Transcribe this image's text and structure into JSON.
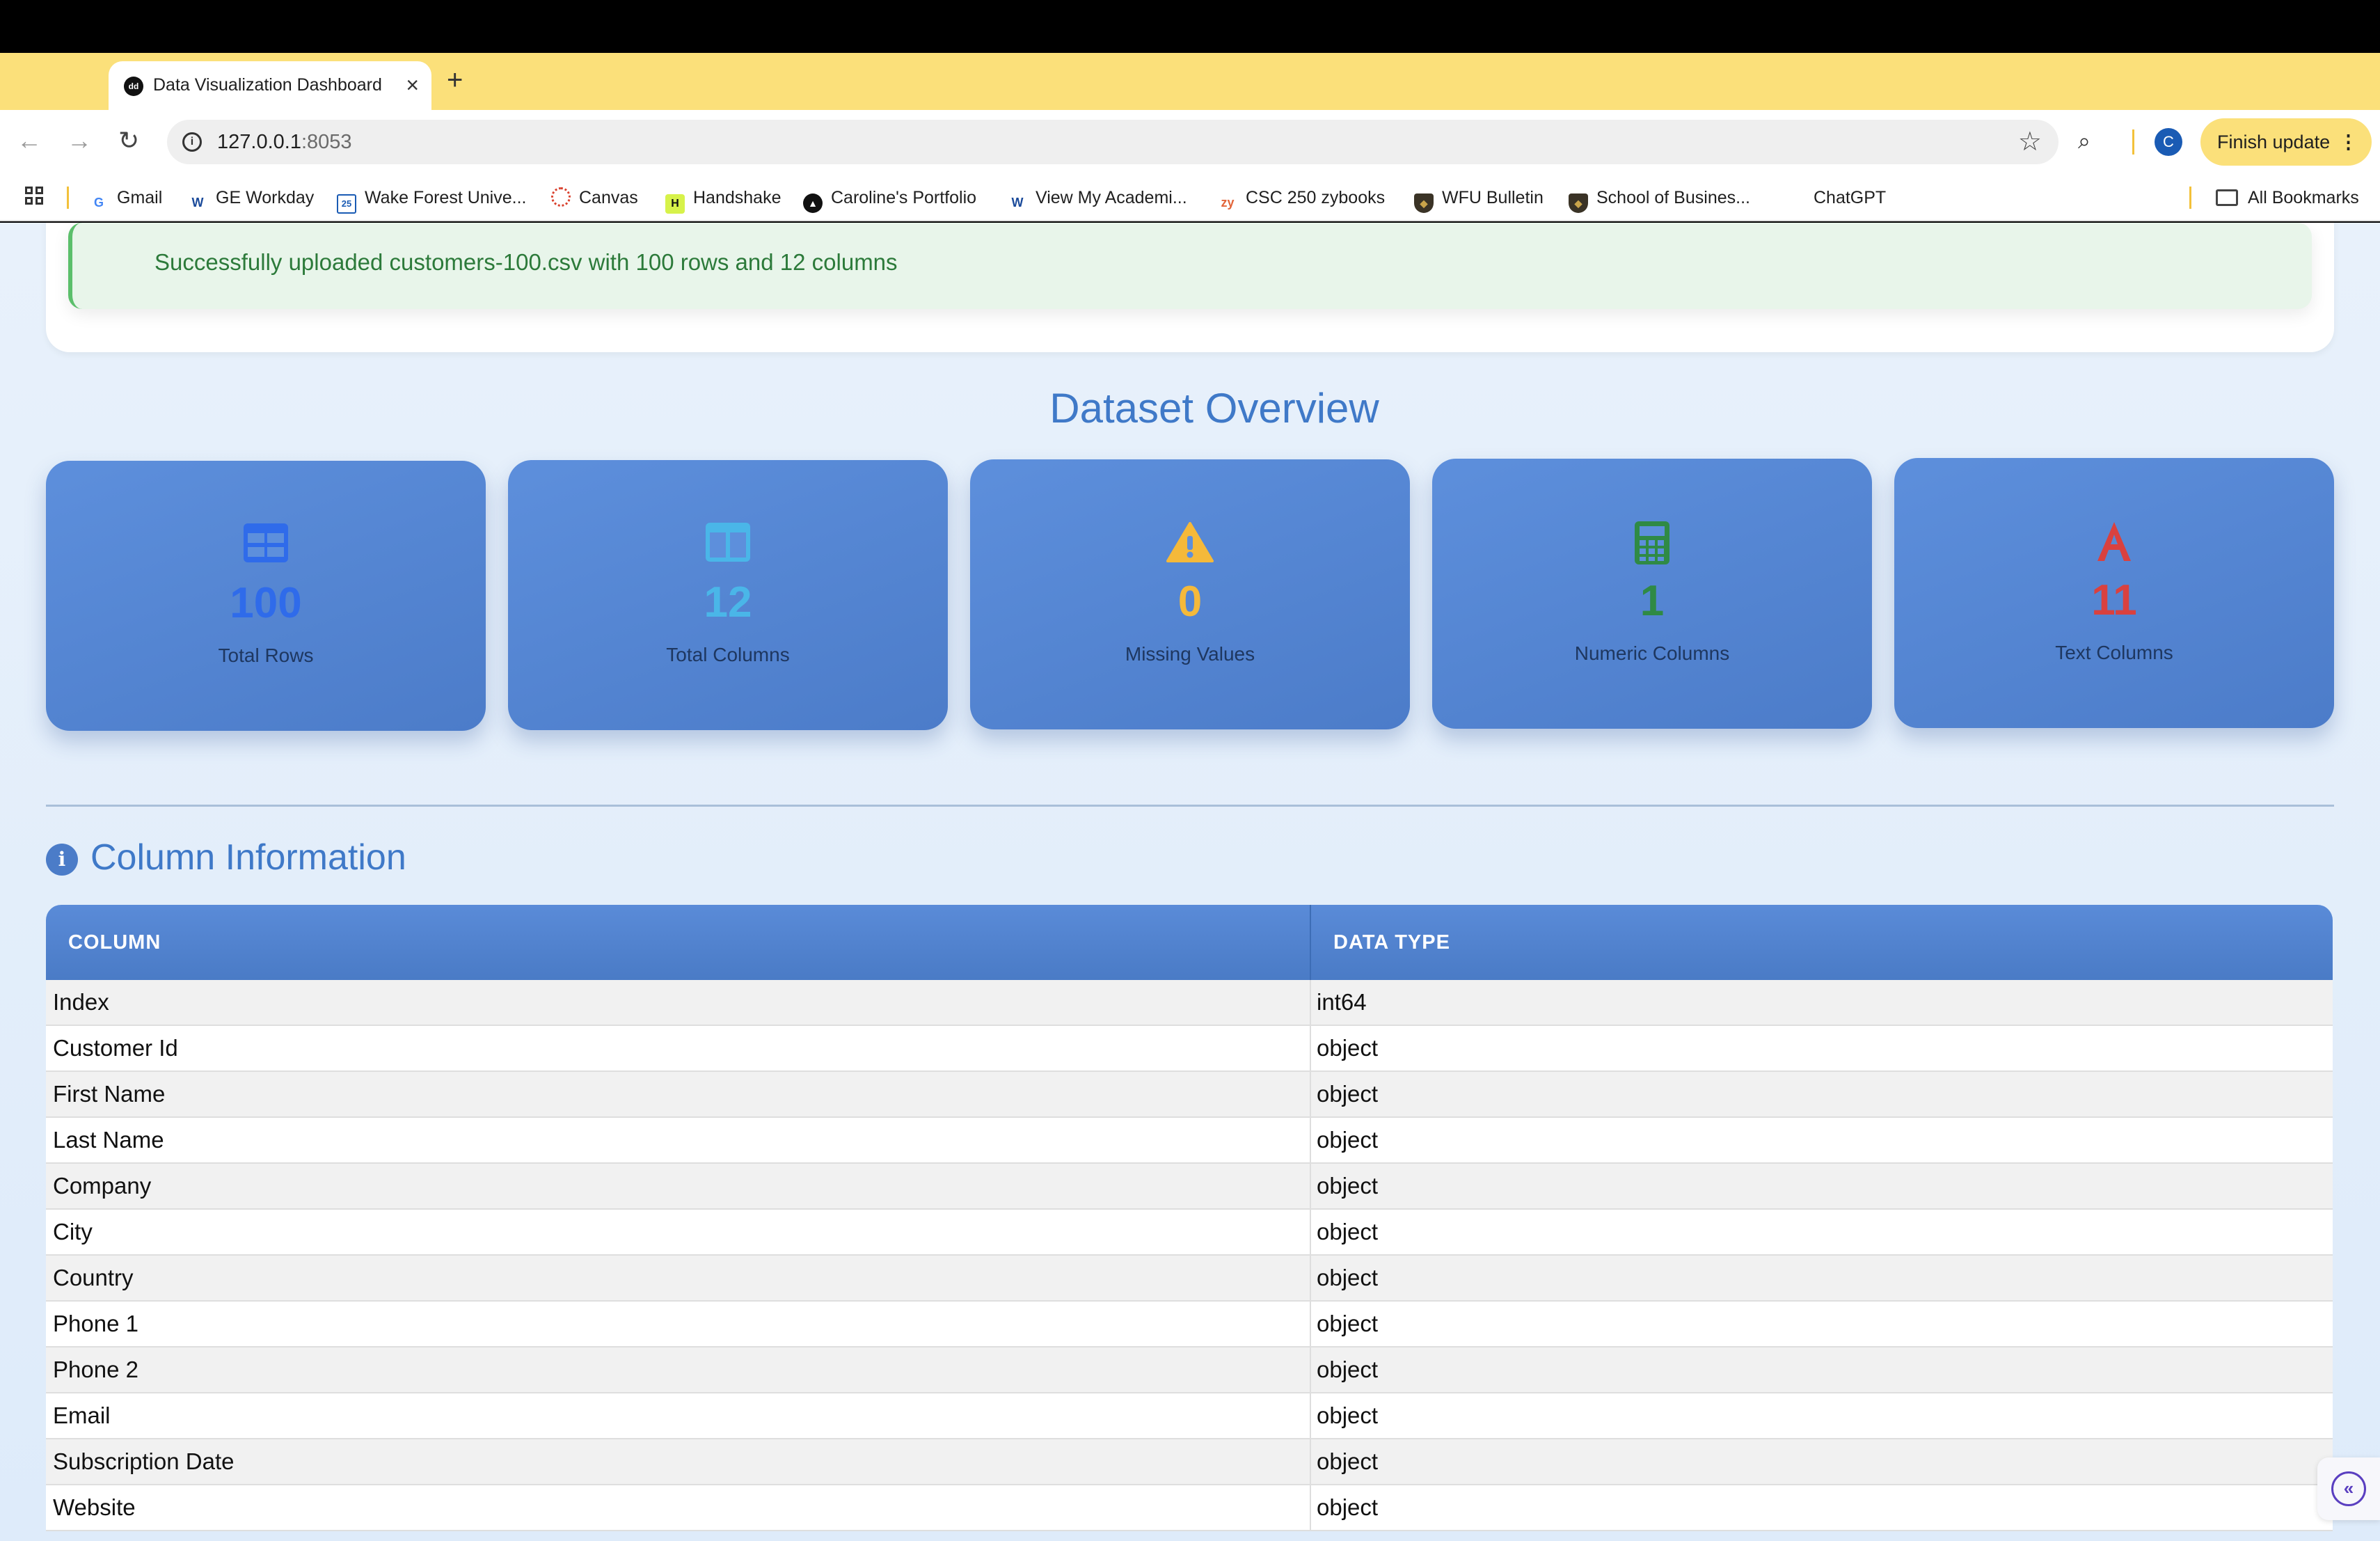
{
  "browser": {
    "tab_title": "Data Visualization Dashboard",
    "url_host": "127.0.0.1",
    "url_port": ":8053",
    "profile_initial": "C",
    "finish_update_label": "Finish update",
    "bookmarks": [
      {
        "label": "Gmail",
        "icon": "google-icon"
      },
      {
        "label": "GE Workday",
        "icon": "workday-icon"
      },
      {
        "label": "Wake Forest Unive...",
        "icon": "calendar-icon"
      },
      {
        "label": "Canvas",
        "icon": "canvas-icon"
      },
      {
        "label": "Handshake",
        "icon": "handshake-icon"
      },
      {
        "label": "Caroline's Portfolio",
        "icon": "portfolio-icon"
      },
      {
        "label": "View My Academi...",
        "icon": "workday-icon"
      },
      {
        "label": "CSC 250 zybooks",
        "icon": "zybooks-icon"
      },
      {
        "label": "WFU Bulletin",
        "icon": "shield-icon"
      },
      {
        "label": "School of Busines...",
        "icon": "shield-icon"
      },
      {
        "label": "ChatGPT",
        "icon": ""
      }
    ],
    "all_bookmarks_label": "All Bookmarks"
  },
  "upload": {
    "message": "Successfully uploaded customers-100.csv with 100 rows and 12 columns"
  },
  "overview": {
    "title": "Dataset Overview",
    "stats": [
      {
        "value": "100",
        "label": "Total Rows",
        "icon": "table-icon",
        "color": "#2f6bea"
      },
      {
        "value": "12",
        "label": "Total Columns",
        "icon": "columns-icon",
        "color": "#4ab6e8"
      },
      {
        "value": "0",
        "label": "Missing Values",
        "icon": "warning-icon",
        "color": "#f5b93a"
      },
      {
        "value": "1",
        "label": "Numeric Columns",
        "icon": "calculator-icon",
        "color": "#2f8a45"
      },
      {
        "value": "11",
        "label": "Text Columns",
        "icon": "font-icon",
        "color": "#d9413f"
      }
    ]
  },
  "column_info": {
    "title": "Column Information",
    "headers": [
      "COLUMN",
      "DATA TYPE"
    ],
    "rows": [
      [
        "Index",
        "int64"
      ],
      [
        "Customer Id",
        "object"
      ],
      [
        "First Name",
        "object"
      ],
      [
        "Last Name",
        "object"
      ],
      [
        "Company",
        "object"
      ],
      [
        "City",
        "object"
      ],
      [
        "Country",
        "object"
      ],
      [
        "Phone 1",
        "object"
      ],
      [
        "Phone 2",
        "object"
      ],
      [
        "Email",
        "object"
      ],
      [
        "Subscription Date",
        "object"
      ],
      [
        "Website",
        "object"
      ]
    ]
  }
}
